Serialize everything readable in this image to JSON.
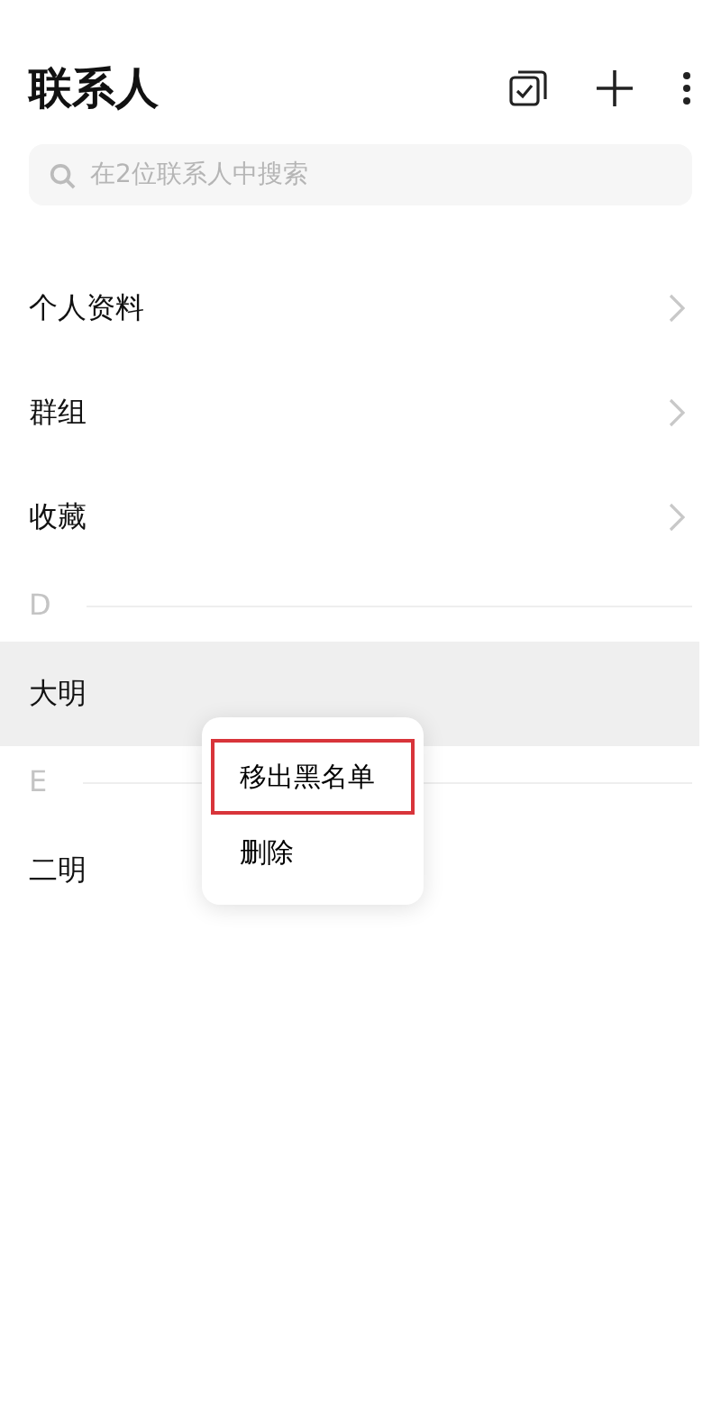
{
  "header": {
    "title": "联系人"
  },
  "search": {
    "placeholder": "在2位联系人中搜索"
  },
  "rows": [
    {
      "kind": "nav",
      "label": "个人资料"
    },
    {
      "kind": "nav",
      "label": "群组"
    },
    {
      "kind": "nav",
      "label": "收藏"
    },
    {
      "kind": "section",
      "label": "D"
    },
    {
      "kind": "contact",
      "label": "大明",
      "selected": true
    },
    {
      "kind": "section",
      "label": "E"
    },
    {
      "kind": "contact",
      "label": "二明",
      "selected": false
    }
  ],
  "context_menu": {
    "items": [
      {
        "label": "移出黑名单",
        "highlighted": true
      },
      {
        "label": "删除",
        "highlighted": false
      }
    ]
  }
}
